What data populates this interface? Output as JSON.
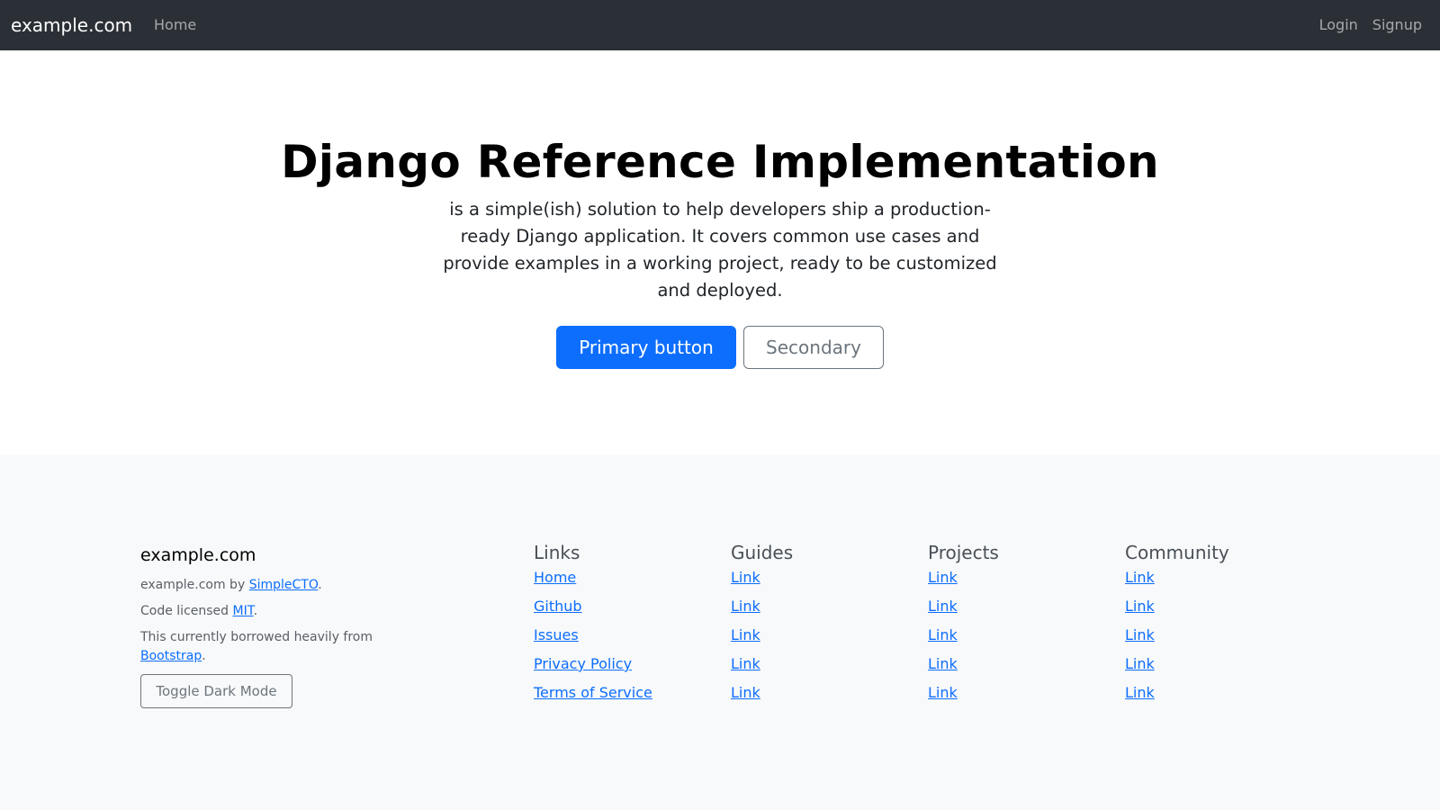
{
  "navbar": {
    "brand": "example.com",
    "home": "Home",
    "login": "Login",
    "signup": "Signup"
  },
  "hero": {
    "title": "Django Reference Implementation",
    "lead": "is a simple(ish) solution to help developers ship a production-ready Django application. It covers common use cases and provide examples in a working project, ready to be customized and deployed.",
    "primary_button": "Primary button",
    "secondary_button": "Secondary"
  },
  "footer": {
    "brand": "example.com",
    "byline_prefix": "example.com by ",
    "byline_link": "SimpleCTO",
    "license_prefix": "Code licensed ",
    "license_link": "MIT",
    "borrowed_prefix": "This currently borrowed heavily from ",
    "borrowed_link": "Bootstrap",
    "period": ".",
    "toggle_dark_mode": "Toggle Dark Mode",
    "columns": [
      {
        "title": "Links",
        "items": [
          "Home",
          "Github",
          "Issues",
          "Privacy Policy",
          "Terms of Service"
        ]
      },
      {
        "title": "Guides",
        "items": [
          "Link",
          "Link",
          "Link",
          "Link",
          "Link"
        ]
      },
      {
        "title": "Projects",
        "items": [
          "Link",
          "Link",
          "Link",
          "Link",
          "Link"
        ]
      },
      {
        "title": "Community",
        "items": [
          "Link",
          "Link",
          "Link",
          "Link",
          "Link"
        ]
      }
    ]
  },
  "colors": {
    "navbar_bg": "#2b2f36",
    "primary": "#0d6efd",
    "secondary": "#6c757d",
    "footer_bg": "#f8f9fa"
  }
}
